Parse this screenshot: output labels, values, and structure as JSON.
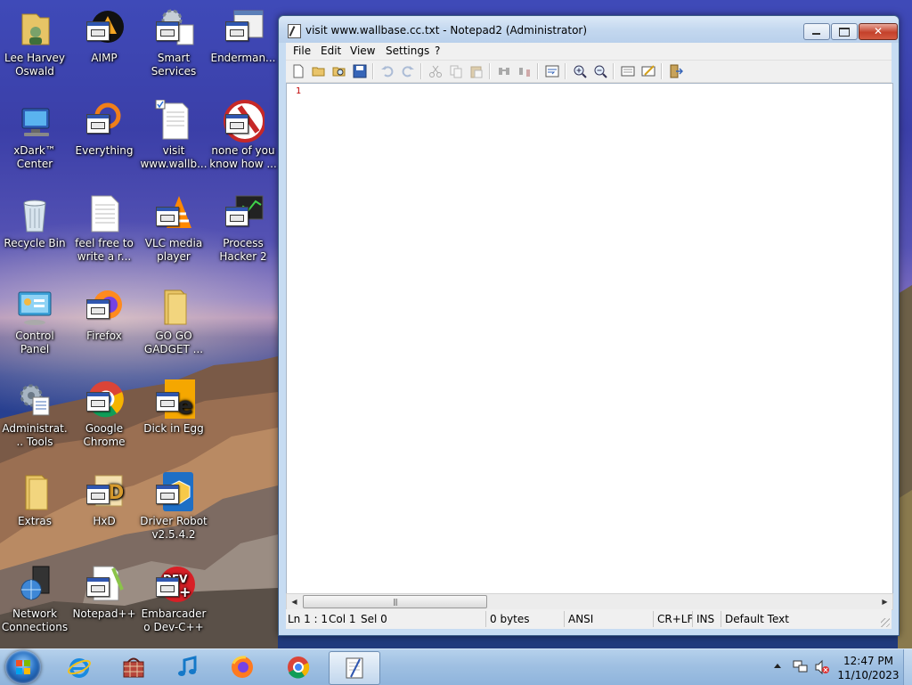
{
  "desktop": {
    "icons": [
      {
        "label": "Lee Harvey Oswald",
        "icon": "folder-user-icon"
      },
      {
        "label": "AIMP",
        "icon": "aimp-icon"
      },
      {
        "label": "Smart Services",
        "icon": "gears-icon"
      },
      {
        "label": "Enderman...",
        "icon": "window-app-icon"
      },
      {
        "label": "xDark™ Center",
        "icon": "computer-icon"
      },
      {
        "label": "Everything",
        "icon": "everything-search-icon"
      },
      {
        "label": "visit www.wallb...",
        "icon": "text-file-icon"
      },
      {
        "label": "none of you know how ...",
        "icon": "red-circle-app-icon"
      },
      {
        "label": "Recycle Bin",
        "icon": "recycle-bin-icon"
      },
      {
        "label": "feel free to write a r...",
        "icon": "text-file-icon"
      },
      {
        "label": "VLC media player",
        "icon": "vlc-icon"
      },
      {
        "label": "Process Hacker 2",
        "icon": "process-hacker-icon"
      },
      {
        "label": "Control Panel",
        "icon": "control-panel-icon"
      },
      {
        "label": "Firefox",
        "icon": "firefox-icon"
      },
      {
        "label": "GO GO GADGET ...",
        "icon": "folder-icon"
      },
      {
        "label": "Administrat... Tools",
        "icon": "admin-tools-icon"
      },
      {
        "label": "Google Chrome",
        "icon": "chrome-icon"
      },
      {
        "label": "Dick in Egg",
        "icon": "egg-app-icon"
      },
      {
        "label": "Extras",
        "icon": "folder-icon"
      },
      {
        "label": "HxD",
        "icon": "hxd-icon"
      },
      {
        "label": "Driver Robot v2.5.4.2",
        "icon": "driver-robot-icon"
      },
      {
        "label": "Network Connections",
        "icon": "network-icon"
      },
      {
        "label": "Notepad++",
        "icon": "notepadpp-icon"
      },
      {
        "label": "Embarcadero Dev-C++",
        "icon": "devcpp-icon"
      }
    ]
  },
  "window": {
    "title": "visit www.wallbase.cc.txt - Notepad2 (Administrator)",
    "menu": [
      "File",
      "Edit",
      "View",
      "Settings",
      "?"
    ],
    "editor": {
      "line_number": "1"
    },
    "status": {
      "position": "Ln 1 : 1",
      "col": "Col 1",
      "sel": "Sel 0",
      "size": "0 bytes",
      "encoding": "ANSI",
      "line_ending": "CR+LF",
      "mode": "INS",
      "scheme": "Default Text"
    }
  },
  "taskbar": {
    "items": [
      "internet-explorer-icon",
      "hamper-app-icon",
      "music-note-icon",
      "firefox-icon",
      "chrome-icon",
      "notepad2-icon"
    ],
    "clock": {
      "time": "12:47 PM",
      "date": "11/10/2023"
    }
  }
}
